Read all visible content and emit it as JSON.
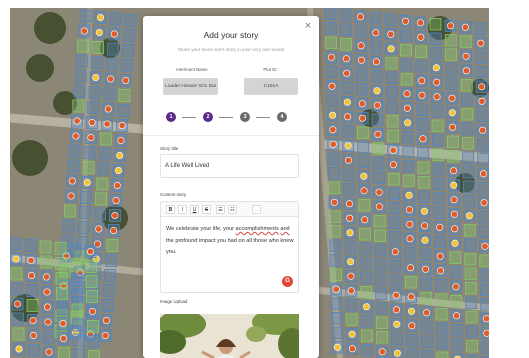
{
  "modal": {
    "title": "Add your story",
    "subtitle": "Share your loved one's story in your very own words",
    "close_symbol": "×",
    "interment_label": "Interment Name",
    "interment_value": "Loader Horace' Eric Dai",
    "plot_label": "Plot ID",
    "plot_value": "C101A",
    "steps": [
      "1",
      "2",
      "3",
      "4"
    ],
    "current_step": 2,
    "story_title_label": "Story title",
    "story_title_value": "A Life Well Lived",
    "content_label": "Content story",
    "toolbar": {
      "bold": "B",
      "italic": "I",
      "underline": "U",
      "strike": "S",
      "list_ordered": "☰",
      "list_bulleted": "☷",
      "link": "…"
    },
    "content_pre": "We celebrate your life, your ",
    "content_flagged_1": "accomplishments",
    "content_mid": " ",
    "content_flagged_2": "and",
    "content_post": " the profound impact you had on all those who knew you.",
    "image_upload_label": "Image Upload"
  },
  "icons": {
    "close": "close-icon",
    "grammar": "grammar-assistant-icon"
  },
  "colors": {
    "step_active": "#5b2a86",
    "step_inactive": "#6b6b6b",
    "info_box": "#d4d4d4",
    "map_ground": "#8c8676",
    "plot_blue": "#4f86c6",
    "plot_green": "#7ecb6b",
    "marker_red": "#e05a2a",
    "marker_yellow": "#f1c232"
  }
}
